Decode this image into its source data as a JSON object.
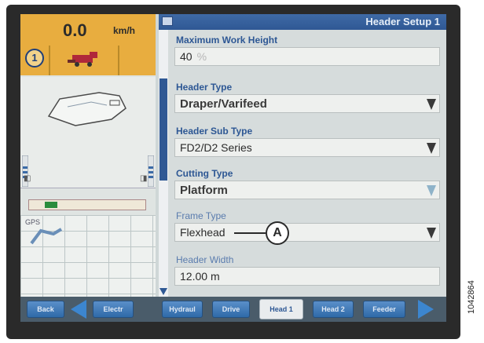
{
  "status": {
    "speed_value": "0.0",
    "speed_unit": "km/h",
    "machine_number": "1",
    "gps_label": "GPS"
  },
  "header": {
    "title": "Header Setup 1"
  },
  "fields": [
    {
      "label": "Maximum Work Height",
      "value": "40",
      "unit": "%"
    },
    {
      "label": "Header Type",
      "value": "Draper/Varifeed"
    },
    {
      "label": "Header Sub Type",
      "value": "FD2/D2 Series"
    },
    {
      "label": "Cutting Type",
      "value": "Platform"
    },
    {
      "label": "Frame Type",
      "value": "Flexhead"
    },
    {
      "label": "Header Width",
      "value": "12.00",
      "unit": "m"
    }
  ],
  "callout": {
    "label": "A"
  },
  "nav": {
    "back": "Back",
    "tabs": [
      "Electr",
      "Hydraul",
      "Drive",
      "Head 1",
      "Head 2",
      "Feeder"
    ],
    "active_tab": "Head 1"
  },
  "figure_id": "1042864",
  "colors": {
    "accent_blue": "#2f5894",
    "speed_panel": "#e8ad3f",
    "nav_button": "#2f6aa8"
  },
  "icons": {
    "machine": "combine-icon",
    "scroll_down": "chevron-down-icon",
    "nav_prev": "arrow-left-icon",
    "nav_next": "arrow-right-icon"
  }
}
